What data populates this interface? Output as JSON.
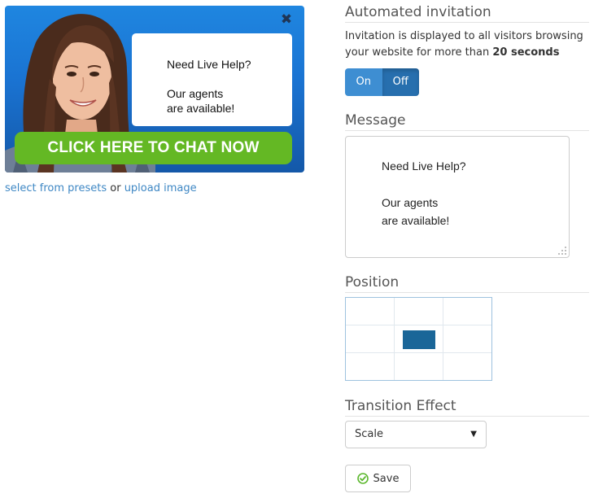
{
  "preview": {
    "bubble_line1": "Need Live Help?",
    "bubble_line2": "Our agents",
    "bubble_line3": "are available!",
    "cta_label": "CLICK HERE TO CHAT NOW",
    "close_symbol": "✖",
    "icons": {
      "close": "close-icon",
      "photo": "agent-photo"
    },
    "colors": {
      "banner": "#1a73d2",
      "cta": "#64b824"
    }
  },
  "preset_links": {
    "select_presets": "select from presets",
    "or_text": "or",
    "upload_image": "upload image"
  },
  "invitation": {
    "title": "Automated invitation",
    "desc_text": "Invitation is displayed to all visitors browsing your website for more than",
    "desc_seconds": "20 seconds",
    "toggle_on": "On",
    "toggle_off": "Off",
    "selected": "Off"
  },
  "message": {
    "title": "Message",
    "line1": "Need Live Help?",
    "line2": "Our agents",
    "line3": "are available!"
  },
  "position": {
    "title": "Position",
    "rows": 3,
    "cols": 3,
    "selected_cell": "middle-center",
    "marker_color": "#1a6698"
  },
  "transition": {
    "title": "Transition Effect",
    "selected": "Scale"
  },
  "save": {
    "label": "Save",
    "icon": "check-circle-icon"
  }
}
